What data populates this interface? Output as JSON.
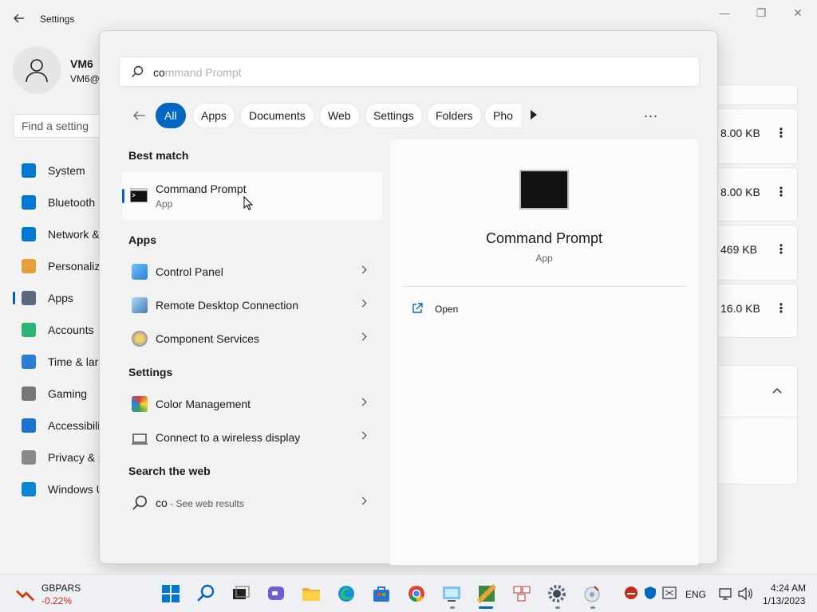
{
  "settings_window": {
    "title": "Settings",
    "user": {
      "name": "VM6",
      "email": "VM6@"
    },
    "search_placeholder": "Find a setting",
    "nav": [
      {
        "label": "System",
        "icon": "monitor-icon",
        "color": "#0078d4"
      },
      {
        "label": "Bluetooth",
        "icon": "bluetooth-icon",
        "color": "#0078d4"
      },
      {
        "label": "Network &",
        "icon": "wifi-icon",
        "color": "#0078d4"
      },
      {
        "label": "Personaliz",
        "icon": "brush-icon",
        "color": "#e8a13a"
      },
      {
        "label": "Apps",
        "icon": "apps-icon",
        "color": "#5b6b7d",
        "active": true
      },
      {
        "label": "Accounts",
        "icon": "person-icon",
        "color": "#2bb673"
      },
      {
        "label": "Time & lar",
        "icon": "clock-icon",
        "color": "#2a7fd4"
      },
      {
        "label": "Gaming",
        "icon": "gamepad-icon",
        "color": "#777777"
      },
      {
        "label": "Accessibili",
        "icon": "accessibility-icon",
        "color": "#1a73d1"
      },
      {
        "label": "Privacy & s",
        "icon": "shield-icon",
        "color": "#8a8a8a"
      },
      {
        "label": "Windows U",
        "icon": "update-icon",
        "color": "#0a84d6"
      }
    ],
    "cards": [
      {
        "size": "8.00 KB"
      },
      {
        "size": "8.00 KB"
      },
      {
        "size": "469 KB"
      },
      {
        "size": "16.0 KB"
      }
    ]
  },
  "search": {
    "typed": "co",
    "ghost": "mmand Prompt",
    "filters": [
      "All",
      "Apps",
      "Documents",
      "Web",
      "Settings",
      "Folders",
      "Pho"
    ],
    "more_label": "..."
  },
  "results": {
    "best_match_title": "Best match",
    "best_match": {
      "name": "Command Prompt",
      "type": "App"
    },
    "apps_title": "Apps",
    "apps": [
      "Control Panel",
      "Remote Desktop Connection",
      "Component Services"
    ],
    "settings_title": "Settings",
    "settings": [
      "Color Management",
      "Connect to a wireless display"
    ],
    "web_title": "Search the web",
    "web": {
      "query": "co",
      "suffix": " - See web results"
    }
  },
  "preview": {
    "title": "Command Prompt",
    "subtitle": "App",
    "action_open": "Open"
  },
  "taskbar": {
    "weather_title": "GBPARS",
    "weather_value": "-0.22%",
    "language": "ENG",
    "time": "4:24 AM",
    "date": "1/13/2023"
  }
}
